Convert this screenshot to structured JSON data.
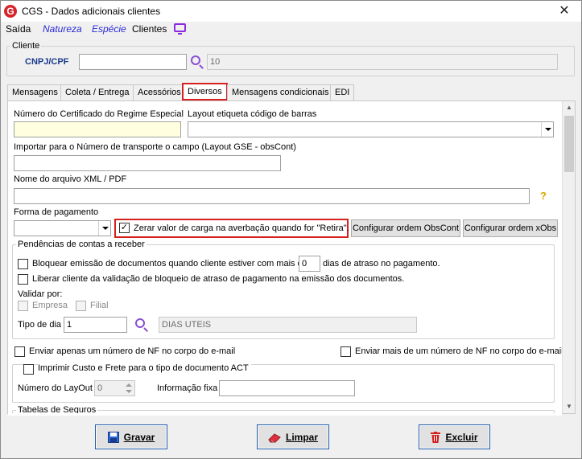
{
  "window": {
    "title": "CGS - Dados adicionais clientes",
    "app_icon": "cgs-logo-icon",
    "close": "✕"
  },
  "menu": {
    "saida": "Saída",
    "natureza": "Natureza",
    "especie": "Espécie",
    "clientes": "Clientes",
    "monitor_icon": "monitor-icon"
  },
  "cliente": {
    "legend": "Cliente",
    "cnpj_label": "CNPJ/CPF",
    "cnpj_value": "",
    "code_value": "10"
  },
  "tabs": [
    {
      "label": "Mensagens"
    },
    {
      "label": "Coleta / Entrega"
    },
    {
      "label": "Acessórios"
    },
    {
      "label": "Diversos"
    },
    {
      "label": "Mensagens condicionais"
    },
    {
      "label": "EDI"
    }
  ],
  "diversos": {
    "cert_label": "Número do Certificado do Regime Especial",
    "cert_value": "",
    "layout_label": "Layout etiqueta código de barras",
    "layout_value": "",
    "importar_label": "Importar para o Número de transporte o campo (Layout GSE - obsCont)",
    "importar_value": "",
    "xml_label": "Nome do arquivo XML / PDF",
    "xml_value": "",
    "help": "?",
    "forma_label": "Forma de pagamento",
    "forma_value": "",
    "zerar_label": "Zerar valor de carga na averbação quando for \"Retira\".",
    "zerar_checked": "✓",
    "btn_obscont": "Configurar ordem ObsCont",
    "btn_xobs": "Configurar ordem xObs"
  },
  "pendencias": {
    "legend": "Pendências de contas a receber",
    "bloquear_label": "Bloquear emissão de documentos quando cliente estiver com mais de",
    "dias_value": "0",
    "dias_label": "dias de atraso no pagamento.",
    "liberar_label": "Liberar cliente da validação de bloqueio de atraso de pagamento na emissão dos documentos.",
    "validar_label": "Validar por:",
    "empresa_label": "Empresa",
    "filial_label": "Filial",
    "tipo_dia_label": "Tipo de dia",
    "tipo_dia_value": "1",
    "tipo_dia_desc": "DIAS UTEIS"
  },
  "nf": {
    "enviar_apenas": "Enviar apenas um número de NF no corpo do e-mail",
    "enviar_mais": "Enviar mais de um número de NF no corpo do e-mail"
  },
  "act": {
    "legend": "Imprimir Custo e Frete para o tipo de documento ACT",
    "layout_label": "Número do LayOut",
    "layout_value": "0",
    "info_label": "Informação fixa",
    "info_value": ""
  },
  "tabelas": {
    "legend": "Tabelas de Seguros"
  },
  "buttons": {
    "gravar": "Gravar",
    "limpar": "Limpar",
    "excluir": "Excluir"
  },
  "colors": {
    "highlight": "#d62020",
    "link": "#2a2ad6",
    "accent": "#8a4fd0"
  }
}
